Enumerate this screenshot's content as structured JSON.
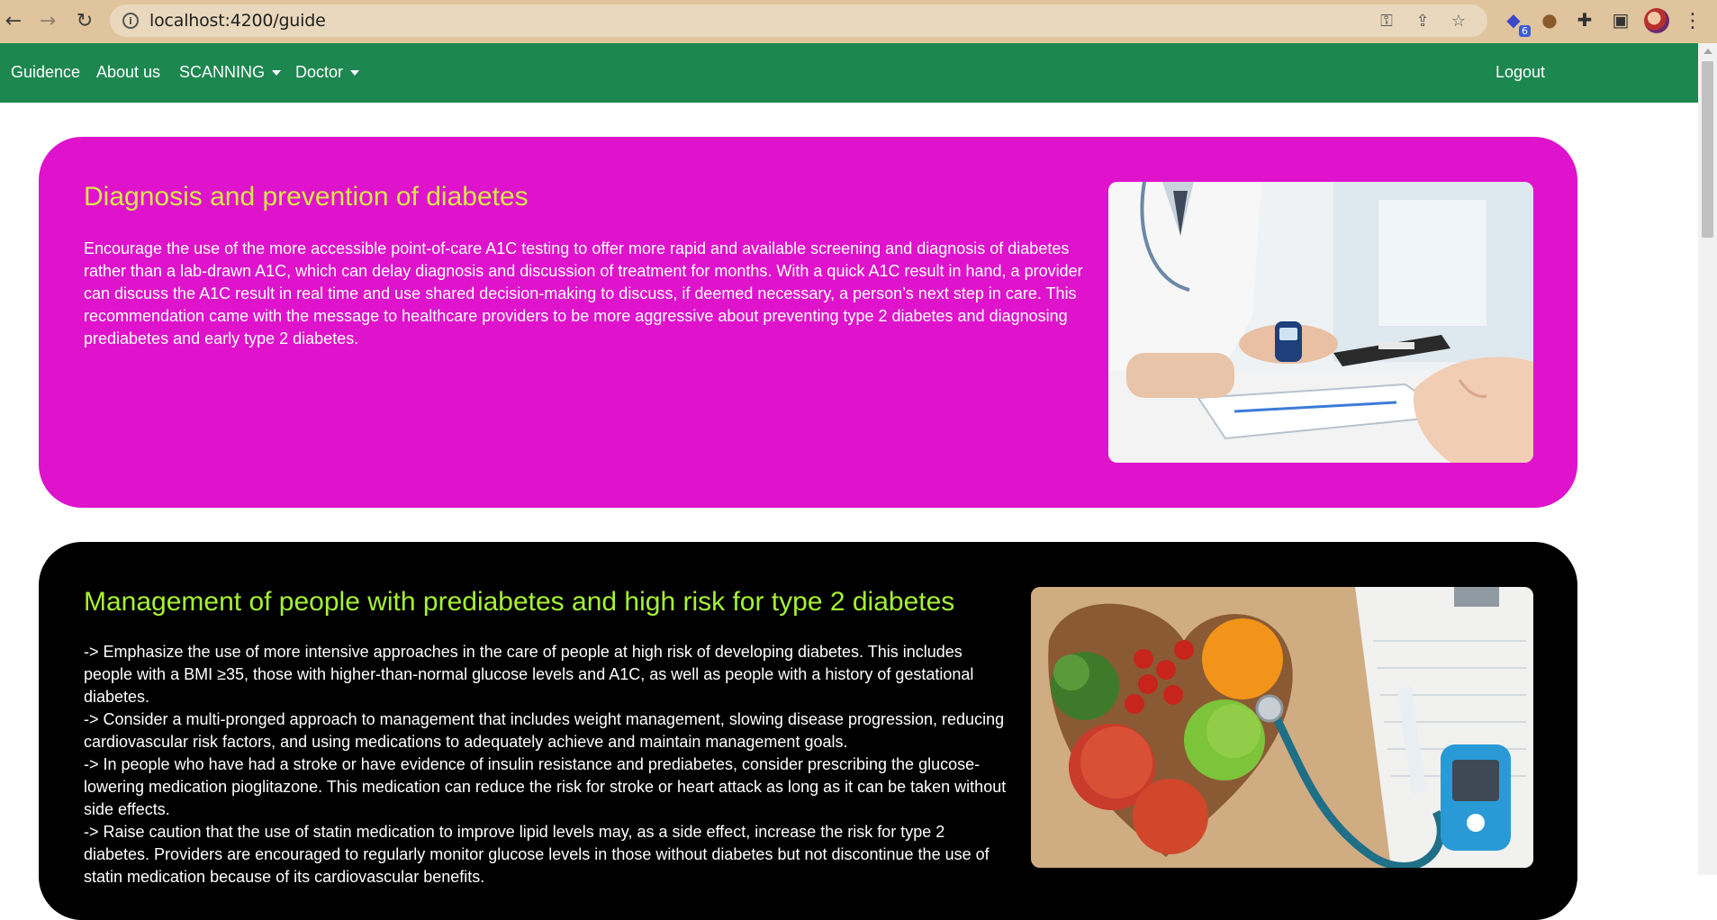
{
  "browser": {
    "back_icon": "arrow-left-icon",
    "forward_icon": "arrow-right-icon",
    "reload_icon": "reload-icon",
    "url": "localhost:4200/guide",
    "extension_badge": "6"
  },
  "navbar": {
    "items": [
      {
        "label": "Guidence"
      },
      {
        "label": "About us"
      },
      {
        "label": "SCANNING"
      },
      {
        "label": "Doctor"
      }
    ],
    "logout": "Logout",
    "background": "#1d8750"
  },
  "sections": [
    {
      "title": "Diagnosis and prevention of diabetes",
      "background": "#de13cb",
      "title_color": "#d7e846",
      "paragraphs": [
        "Encourage the use of the more accessible point-of-care A1C testing to offer more rapid and available screening and diagnosis of diabetes rather than a lab-drawn A1C, which can delay diagnosis and discussion of treatment for months. With a quick A1C result in hand, a provider can discuss the A1C result in real time and use shared decision-making to discuss, if deemed necessary, a person’s next step in care. This recommendation came with the message to healthcare providers to be more aggressive about preventing type 2 diabetes and diagnosing prediabetes and early type 2 diabetes."
      ],
      "image": "doctor-glucometer-photo"
    },
    {
      "title": "Management of people with prediabetes and high risk for type 2 diabetes",
      "background": "#000000",
      "title_color": "#a6f233",
      "paragraphs": [
        "-> Emphasize the use of more intensive approaches in the care of people at high risk of developing diabetes. This includes people with a BMI ≥35, those with higher-than-normal glucose levels and A1C, as well as people with a history of gestational diabetes.",
        "-> Consider a multi-pronged approach to management that includes weight management, slowing disease progression, reducing cardiovascular risk factors, and using medications to adequately achieve and maintain management goals.",
        "-> In people who have had a stroke or have evidence of insulin resistance and prediabetes, consider prescribing the glucose-lowering medication pioglitazone. This medication can reduce the risk for stroke or heart attack as long as it can be taken without side effects.",
        "-> Raise caution that the use of statin medication to improve lipid levels may, as a side effect, increase the risk for type 2 diabetes. Providers are encouraged to regularly monitor glucose levels in those without diabetes but not discontinue the use of statin medication because of its cardiovascular benefits."
      ],
      "image": "heart-bowl-fruit-stethoscope-photo"
    }
  ]
}
